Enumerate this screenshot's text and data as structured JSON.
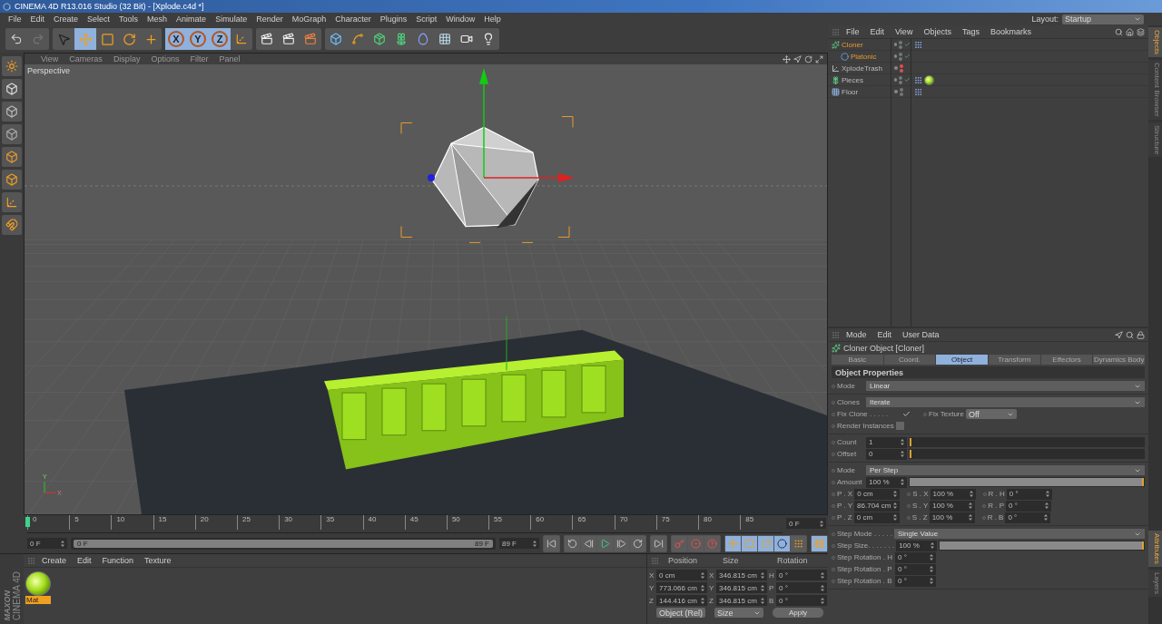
{
  "window": {
    "title": "CINEMA 4D R13.016 Studio (32 Bit) - [Xplode.c4d *]"
  },
  "menu_bar": [
    "File",
    "Edit",
    "Create",
    "Select",
    "Tools",
    "Mesh",
    "Animate",
    "Simulate",
    "Render",
    "MoGraph",
    "Character",
    "Plugins",
    "Script",
    "Window",
    "Help"
  ],
  "layout": {
    "label": "Layout:",
    "value": "Startup"
  },
  "toolbar": {
    "tools": [
      {
        "kind": "select",
        "selected": false
      },
      {
        "kind": "move",
        "selected": true
      },
      {
        "kind": "scale",
        "selected": false
      },
      {
        "kind": "rotate",
        "selected": false
      },
      {
        "kind": "add",
        "selected": false
      }
    ],
    "axes": [
      {
        "label": "X",
        "selected": true
      },
      {
        "label": "Y",
        "selected": true
      },
      {
        "label": "Z",
        "selected": true
      }
    ]
  },
  "viewport": {
    "menu": [
      "View",
      "Cameras",
      "Display",
      "Options",
      "Filter",
      "Panel"
    ],
    "camera": "Perspective",
    "axis_labels": [
      "Y",
      "X"
    ]
  },
  "timeline": {
    "ticks": [
      "0",
      "5",
      "10",
      "15",
      "20",
      "25",
      "30",
      "35",
      "40",
      "45",
      "50",
      "55",
      "60",
      "65",
      "70",
      "75",
      "80",
      "85"
    ],
    "current": "0 F",
    "start": "0 F",
    "range": {
      "start": "0 F",
      "end": "89 F",
      "level": 1
    },
    "end": "89 F"
  },
  "materials": {
    "menu": [
      "Create",
      "Edit",
      "Function",
      "Texture"
    ],
    "items": [
      {
        "name": "Mat",
        "selected": true
      }
    ]
  },
  "logo": {
    "brand": "MAXON",
    "product": "CINEMA 4D"
  },
  "coordinates": {
    "headers": [
      "Position",
      "Size",
      "Rotation"
    ],
    "rows": [
      [
        {
          "axis": "X",
          "value": "0 cm"
        },
        {
          "axis": "X",
          "value": "346.815 cm"
        },
        {
          "axis": "H",
          "value": "0 °"
        }
      ],
      [
        {
          "axis": "Y",
          "value": "773.066 cm"
        },
        {
          "axis": "Y",
          "value": "346.815 cm"
        },
        {
          "axis": "P",
          "value": "0 °"
        }
      ],
      [
        {
          "axis": "Z",
          "value": "144.416 cm"
        },
        {
          "axis": "Z",
          "value": "346.815 cm"
        },
        {
          "axis": "B",
          "value": "0 °"
        }
      ]
    ],
    "mode": "Object (Rel)",
    "size_mode": "Size",
    "apply": "Apply"
  },
  "object_manager": {
    "menu": [
      "File",
      "Edit",
      "View",
      "Objects",
      "Tags",
      "Bookmarks"
    ],
    "objects": [
      {
        "name": "Cloner",
        "kind": "cloner",
        "selected": true,
        "enabled": true,
        "hidden": false,
        "tags": [
          {
            "kind": "phong"
          }
        ],
        "children": [
          {
            "name": "Platonic",
            "kind": "sphere",
            "selected": true,
            "enabled": true,
            "hidden": false
          }
        ]
      },
      {
        "name": "XplodeTrash",
        "kind": "null",
        "selected": false,
        "enabled": false,
        "hidden": true
      },
      {
        "name": "Pieces",
        "kind": "fracture",
        "selected": false,
        "enabled": true,
        "hidden": false,
        "tags": [
          {
            "kind": "phong"
          },
          {
            "kind": "material"
          }
        ]
      },
      {
        "name": "Floor",
        "kind": "floor",
        "selected": false,
        "enabled": false,
        "hidden": false,
        "tags": [
          {
            "kind": "phong"
          }
        ]
      }
    ]
  },
  "attributes": {
    "menu": [
      "Mode",
      "Edit",
      "User Data"
    ],
    "title": "Cloner Object [Cloner]",
    "tabs": [
      {
        "label": "Basic",
        "selected": false
      },
      {
        "label": "Coord.",
        "selected": false
      },
      {
        "label": "Object",
        "selected": true
      },
      {
        "label": "Transform",
        "selected": false
      },
      {
        "label": "Effectors",
        "selected": false
      },
      {
        "label": "Dynamics Body",
        "selected": false
      }
    ],
    "section": "Object Properties",
    "groups": [
      [
        {
          "kind": "dropdown",
          "label": "Mode",
          "value": "Linear"
        }
      ],
      [
        {
          "kind": "dropdown",
          "label": "Clones",
          "value": "Iterate"
        },
        {
          "kind": "checkpair",
          "label": "Fix Clone . . . . .",
          "checked": true,
          "label2": "Fix Texture",
          "value": "Off"
        },
        {
          "kind": "checkbox",
          "label": "Render Instances",
          "checked": false
        }
      ],
      [
        {
          "kind": "slider",
          "label": "Count",
          "value": "1",
          "level": 0
        },
        {
          "kind": "slider",
          "label": "Offset",
          "value": "0",
          "level": 0
        }
      ],
      [
        {
          "kind": "dropdown",
          "label": "Mode",
          "value": "Per Step"
        },
        {
          "kind": "slider",
          "label": "Amount",
          "value": "100 %",
          "level": 1
        },
        {
          "kind": "triple",
          "cells": [
            {
              "label": "P . X",
              "value": "0 cm"
            },
            {
              "label": "S . X",
              "value": "100 %"
            },
            {
              "label": "R . H",
              "value": "0 °"
            }
          ]
        },
        {
          "kind": "triple",
          "cells": [
            {
              "label": "P . Y",
              "value": "86.704 cm"
            },
            {
              "label": "S . Y",
              "value": "100 %"
            },
            {
              "label": "R . P",
              "value": "0 °"
            }
          ]
        },
        {
          "kind": "triple",
          "cells": [
            {
              "label": "P . Z",
              "value": "0 cm"
            },
            {
              "label": "S . Z",
              "value": "100 %"
            },
            {
              "label": "R . B",
              "value": "0 °"
            }
          ]
        }
      ],
      [
        {
          "kind": "dropdown",
          "label": "Step Mode . . . . .",
          "value": "Single Value"
        },
        {
          "kind": "slider",
          "label": "Step Size. . . . . . .",
          "value": "100 %",
          "level": 1
        },
        {
          "kind": "number",
          "label": "Step Rotation . H",
          "value": "0 °"
        },
        {
          "kind": "number",
          "label": "Step Rotation . P",
          "value": "0 °"
        },
        {
          "kind": "number",
          "label": "Step Rotation . B",
          "value": "0 °"
        }
      ]
    ]
  },
  "side_tabs": {
    "top": [
      {
        "label": "Objects",
        "selected": true
      },
      {
        "label": "Content Browser",
        "selected": false
      },
      {
        "label": "Structure",
        "selected": false
      }
    ],
    "bottom": [
      {
        "label": "Attributes",
        "selected": true
      },
      {
        "label": "Layers",
        "selected": false
      }
    ]
  }
}
